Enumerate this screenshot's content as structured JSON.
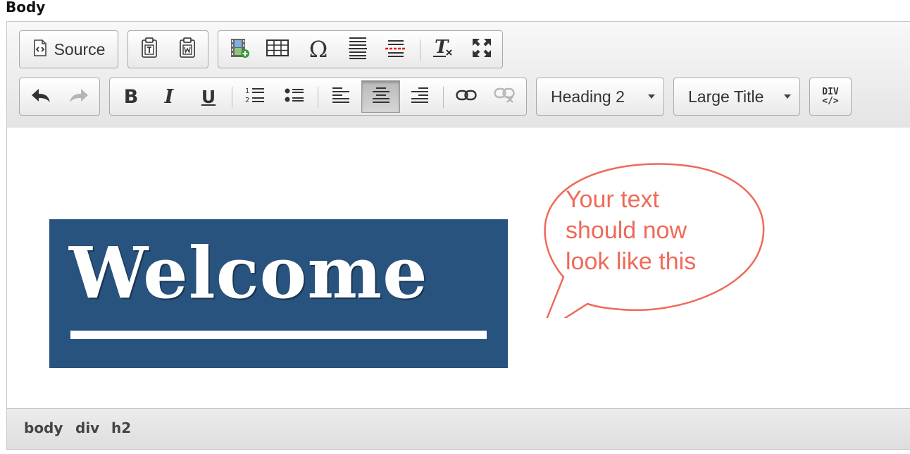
{
  "field_label": "Body",
  "toolbar": {
    "source_label": "Source",
    "format_combo": "Heading 2",
    "style_combo": "Large Title",
    "div_button_label": "DIV"
  },
  "content": {
    "heading_text": "Welcome",
    "callout_lines": [
      "Your text",
      "should now",
      "look like this"
    ]
  },
  "element_path": [
    "body",
    "div",
    "h2"
  ],
  "colors": {
    "heading_bg": "#28537e",
    "callout": "#ee6a5a"
  }
}
